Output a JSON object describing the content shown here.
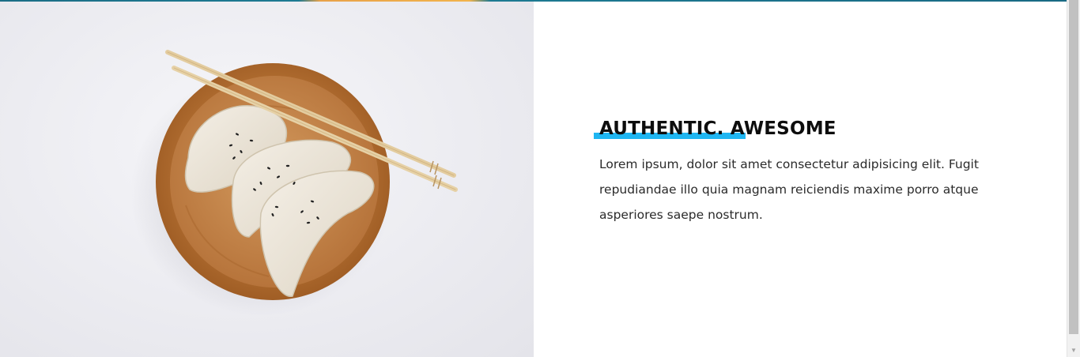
{
  "section": {
    "heading": "AUTHENTIC. AWESOME",
    "body": "Lorem ipsum, dolor sit amet consectetur adipisicing elit. Fugit repudiandae illo quia magnam reiciendis maxime porro atque asperiores saepe nostrum.",
    "accent_color": "#1fb6f2"
  },
  "image": {
    "alt": "dumplings-on-wooden-plate-with-chopsticks"
  },
  "scrollbar": {
    "down_arrow_icon": "chevron-down-icon"
  }
}
